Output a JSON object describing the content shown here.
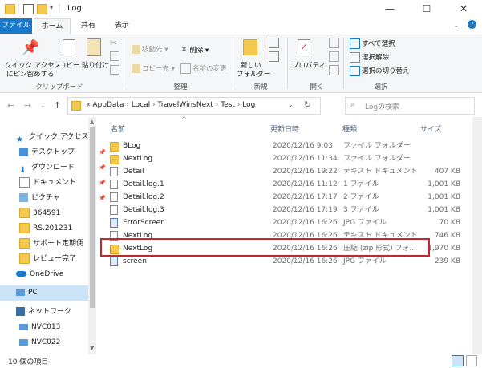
{
  "window": {
    "title": "Log",
    "minimize": "—",
    "maximize": "☐",
    "close": "✕"
  },
  "tabs": [
    {
      "label": "ファイル"
    },
    {
      "label": "ホーム"
    },
    {
      "label": "共有"
    },
    {
      "label": "表示"
    }
  ],
  "ribbon": {
    "pin_label_1": "クイック アクセス",
    "pin_label_2": "にピン留めする",
    "copy": "コピー",
    "paste": "貼り付け",
    "clipboard_group": "クリップボード",
    "move_to": "移動先",
    "copy_to": "コピー先",
    "delete": "削除",
    "rename": "名前の変更",
    "organize_group": "整理",
    "new_folder_1": "新しい",
    "new_folder_2": "フォルダー",
    "new_group": "新規",
    "properties": "プロパティ",
    "open_group": "開く",
    "select_all": "すべて選択",
    "select_none": "選択解除",
    "invert_selection": "選択の切り替え",
    "select_group": "選択"
  },
  "address": {
    "path": [
      "AppData",
      "Local",
      "TravelWinsNext",
      "Test",
      "Log"
    ],
    "prefix": "«",
    "search_placeholder": "Logの検索"
  },
  "nav": {
    "items": [
      {
        "label": "クイック アクセス",
        "icon": "star-icon",
        "pinned": false
      },
      {
        "label": "デスクトップ",
        "icon": "desktop-icon",
        "pinned": true
      },
      {
        "label": "ダウンロード",
        "icon": "download-icon",
        "pinned": true
      },
      {
        "label": "ドキュメント",
        "icon": "documents-icon",
        "pinned": true
      },
      {
        "label": "ピクチャ",
        "icon": "pictures-icon",
        "pinned": true
      },
      {
        "label": "364591",
        "icon": "folder-icon",
        "pinned": false
      },
      {
        "label": "RS.201231",
        "icon": "folder-icon",
        "pinned": false
      },
      {
        "label": "サポート定期便",
        "icon": "folder-icon",
        "pinned": false
      },
      {
        "label": "レビュー完了",
        "icon": "folder-icon",
        "pinned": false
      },
      {
        "label": "OneDrive",
        "icon": "cloud-icon",
        "pinned": false
      },
      {
        "label": "PC",
        "icon": "pc-icon",
        "pinned": false
      },
      {
        "label": "ネットワーク",
        "icon": "network-icon",
        "pinned": false
      },
      {
        "label": "NVC013",
        "icon": "computer-icon",
        "pinned": false
      },
      {
        "label": "NVC022",
        "icon": "computer-icon",
        "pinned": false
      }
    ]
  },
  "columns": {
    "name": "名前",
    "date": "更新日時",
    "type": "種類",
    "size": "サイズ"
  },
  "files": [
    {
      "name": "BLog",
      "date": "2020/12/16 9:03",
      "type": "ファイル フォルダー",
      "size": "",
      "icon": "folder-icon"
    },
    {
      "name": "NextLog",
      "date": "2020/12/16 11:34",
      "type": "ファイル フォルダー",
      "size": "",
      "icon": "folder-icon"
    },
    {
      "name": "Detail",
      "date": "2020/12/16 19:22",
      "type": "テキスト ドキュメント",
      "size": "407 KB",
      "icon": "text-file-icon"
    },
    {
      "name": "Detail.log.1",
      "date": "2020/12/16 11:12",
      "type": "1 ファイル",
      "size": "1,001 KB",
      "icon": "file-icon"
    },
    {
      "name": "Detail.log.2",
      "date": "2020/12/16 17:17",
      "type": "2 ファイル",
      "size": "1,001 KB",
      "icon": "file-icon"
    },
    {
      "name": "Detail.log.3",
      "date": "2020/12/16 17:19",
      "type": "3 ファイル",
      "size": "1,001 KB",
      "icon": "file-icon"
    },
    {
      "name": "ErrorScreen",
      "date": "2020/12/16 16:26",
      "type": "JPG ファイル",
      "size": "70 KB",
      "icon": "image-file-icon"
    },
    {
      "name": "NextLog",
      "date": "2020/12/16 16:26",
      "type": "テキスト ドキュメント",
      "size": "746 KB",
      "icon": "text-file-icon"
    },
    {
      "name": "NextLog",
      "date": "2020/12/16 16:26",
      "type": "圧縮 (zip 形式) フォ...",
      "size": "1,970 KB",
      "icon": "zip-folder-icon"
    },
    {
      "name": "screen",
      "date": "2020/12/16 16:26",
      "type": "JPG ファイル",
      "size": "239 KB",
      "icon": "image-file-icon"
    }
  ],
  "status": {
    "item_count": "10 個の項目"
  },
  "colors": {
    "accent": "#1979ca",
    "highlight_border": "#c1272d",
    "folder": "#f2c94c"
  }
}
